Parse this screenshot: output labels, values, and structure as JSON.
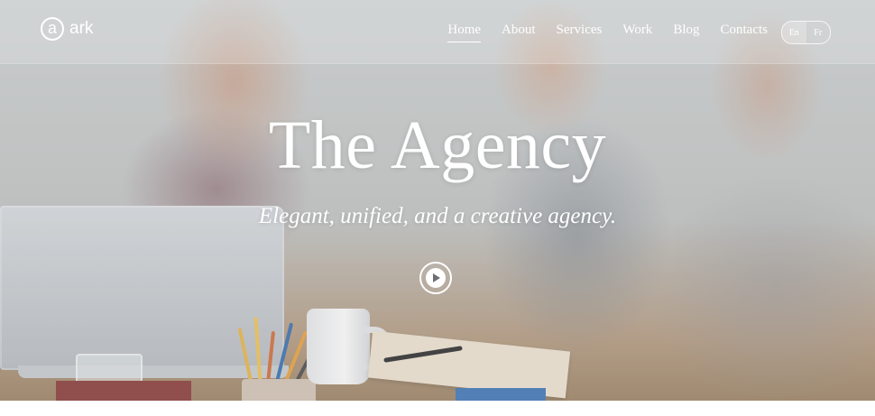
{
  "brand": {
    "mark": "a",
    "name": "ark"
  },
  "nav": {
    "items": [
      {
        "label": "Home",
        "active": true
      },
      {
        "label": "About",
        "active": false
      },
      {
        "label": "Services",
        "active": false
      },
      {
        "label": "Work",
        "active": false
      },
      {
        "label": "Blog",
        "active": false
      },
      {
        "label": "Contacts",
        "active": false
      }
    ],
    "languages": [
      {
        "label": "En",
        "active": true
      },
      {
        "label": "Fr",
        "active": false
      }
    ]
  },
  "hero": {
    "title": "The Agency",
    "subtitle": "Elegant, unified, and a creative agency.",
    "play_icon": "play-icon"
  },
  "colors": {
    "text": "#ffffff",
    "navbar_overlay": "rgba(255,255,255,0.17)"
  }
}
